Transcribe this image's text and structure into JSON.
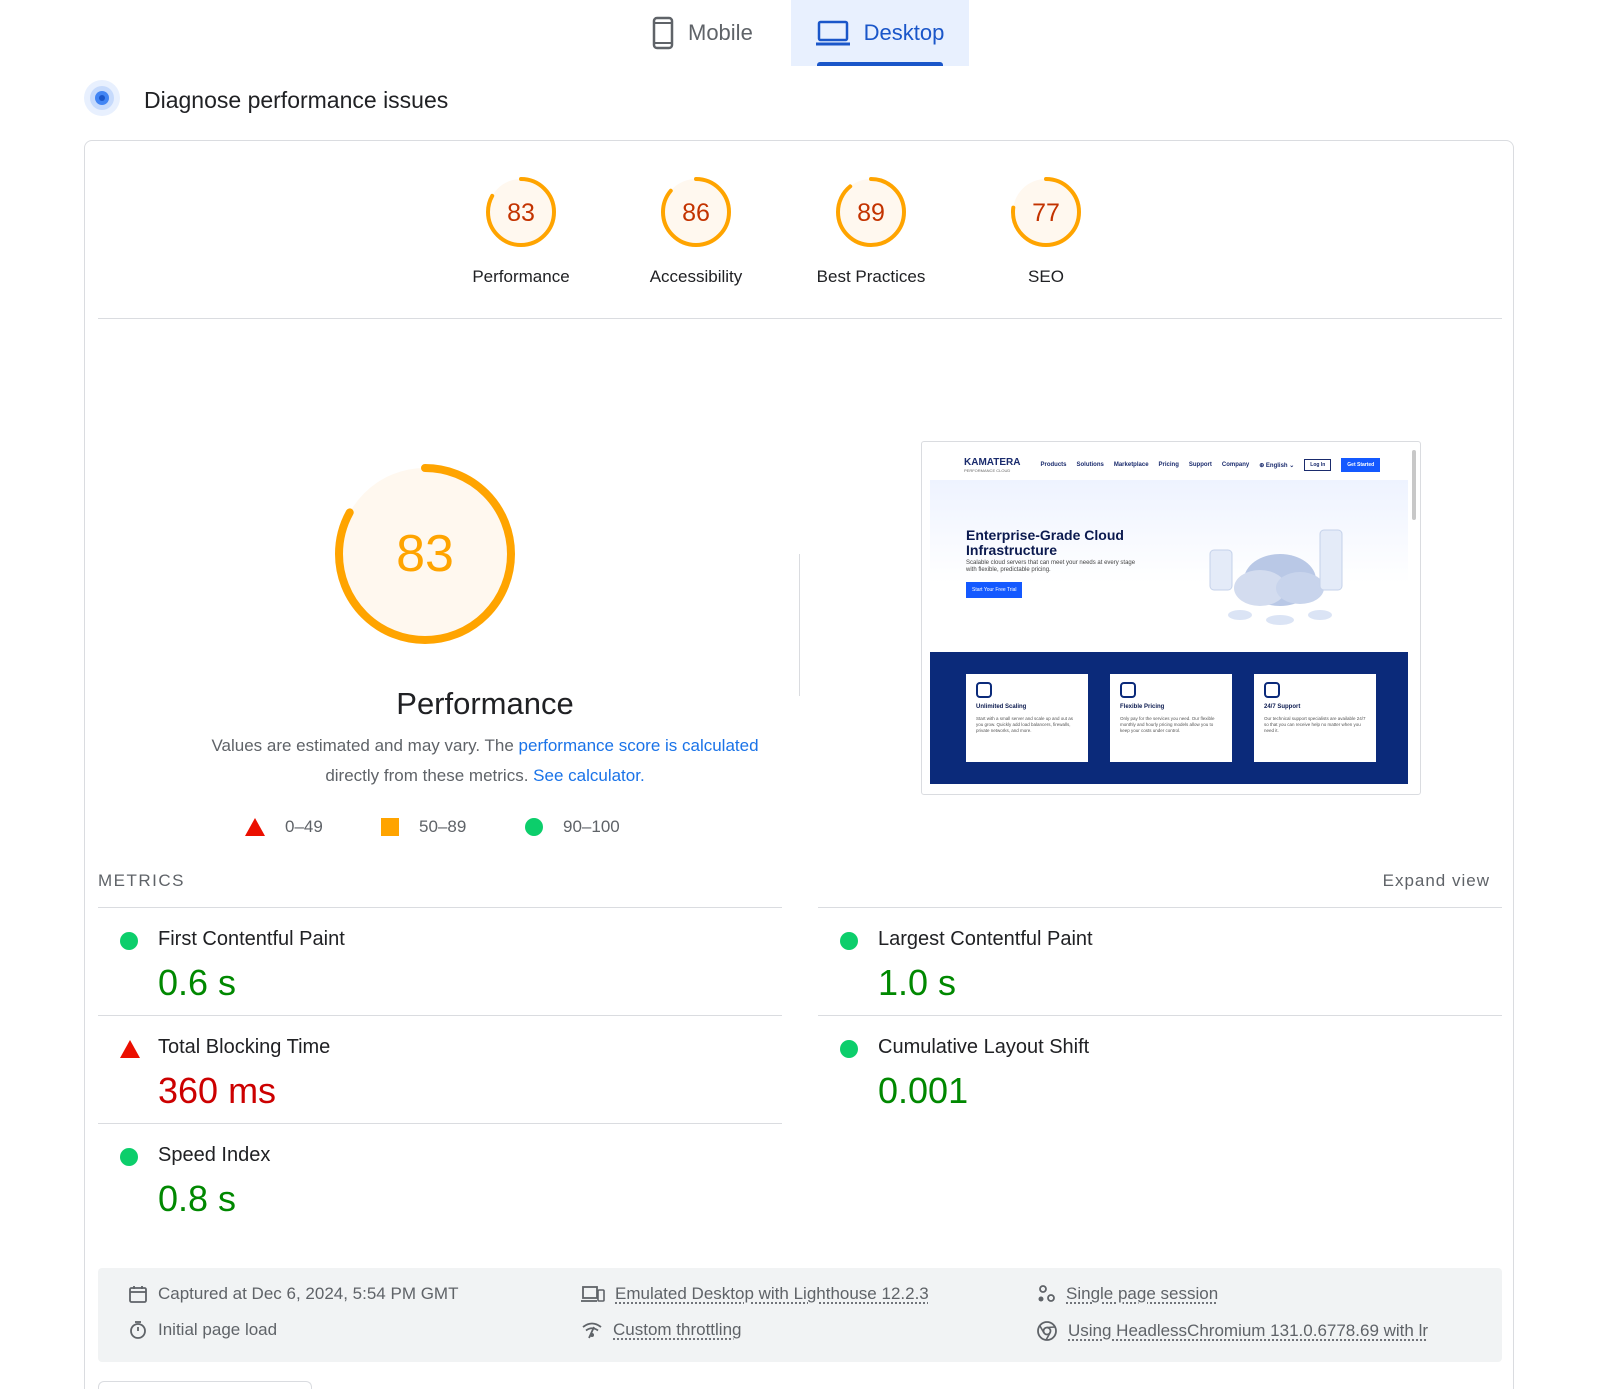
{
  "tabs": {
    "mobile": "Mobile",
    "desktop": "Desktop",
    "active": "desktop"
  },
  "header": {
    "title": "Diagnose performance issues"
  },
  "categories": [
    {
      "score": "83",
      "label": "Performance"
    },
    {
      "score": "86",
      "label": "Accessibility"
    },
    {
      "score": "89",
      "label": "Best Practices"
    },
    {
      "score": "77",
      "label": "SEO"
    }
  ],
  "performance": {
    "score": "83",
    "title": "Performance",
    "desc_prefix": "Values are estimated and may vary. The ",
    "desc_link1": "performance score is calculated",
    "desc_middle": "directly from these metrics. ",
    "desc_link2": "See calculator.",
    "legend": [
      {
        "range": "0–49"
      },
      {
        "range": "50–89"
      },
      {
        "range": "90–100"
      }
    ]
  },
  "thumbnail": {
    "brand": "KAMATERA",
    "brand_sub": "PERFORMANCE CLOUD",
    "nav": [
      "Products",
      "Solutions",
      "Marketplace",
      "Pricing",
      "Support",
      "Company"
    ],
    "lang": "⊕ English ⌄",
    "login": "Log In",
    "start": "Get Started",
    "hero_title": "Enterprise-Grade Cloud Infrastructure",
    "hero_text": "Scalable cloud servers that can meet your needs at every stage with flexible, predictable pricing.",
    "hero_cta": "Start Your Free Trial",
    "features": [
      {
        "title": "Unlimited Scaling",
        "text": "Start with a small server and scale up and out as you grow. Quickly add load balancers, firewalls, private networks, and more."
      },
      {
        "title": "Flexible Pricing",
        "text": "Only pay for the services you need. Our flexible monthly and hourly pricing models allow you to keep your costs under control."
      },
      {
        "title": "24/7 Support",
        "text": "Our technical support specialists are available 24/7 so that you can receive help no matter when you need it."
      }
    ]
  },
  "metrics": {
    "label": "METRICS",
    "expand": "Expand view",
    "items": [
      {
        "name": "First Contentful Paint",
        "value": "0.6 s",
        "status": "good"
      },
      {
        "name": "Largest Contentful Paint",
        "value": "1.0 s",
        "status": "good"
      },
      {
        "name": "Total Blocking Time",
        "value": "360 ms",
        "status": "bad"
      },
      {
        "name": "Cumulative Layout Shift",
        "value": "0.001",
        "status": "good"
      },
      {
        "name": "Speed Index",
        "value": "0.8 s",
        "status": "good"
      }
    ]
  },
  "info": {
    "captured": "Captured at Dec 6, 2024, 5:54 PM GMT",
    "load": "Initial page load",
    "emulated": "Emulated Desktop with Lighthouse 12.2.3",
    "throttling": "Custom throttling",
    "session": "Single page session",
    "browser": "Using HeadlessChromium 131.0.6778.69 with lr"
  },
  "colors": {
    "average": "#ffa400",
    "average_text": "#c33300",
    "good": "#0cce6b",
    "good_text": "#008800",
    "poor": "#eb0f00",
    "poor_text": "#cc0000",
    "accent": "#1a73e8"
  }
}
